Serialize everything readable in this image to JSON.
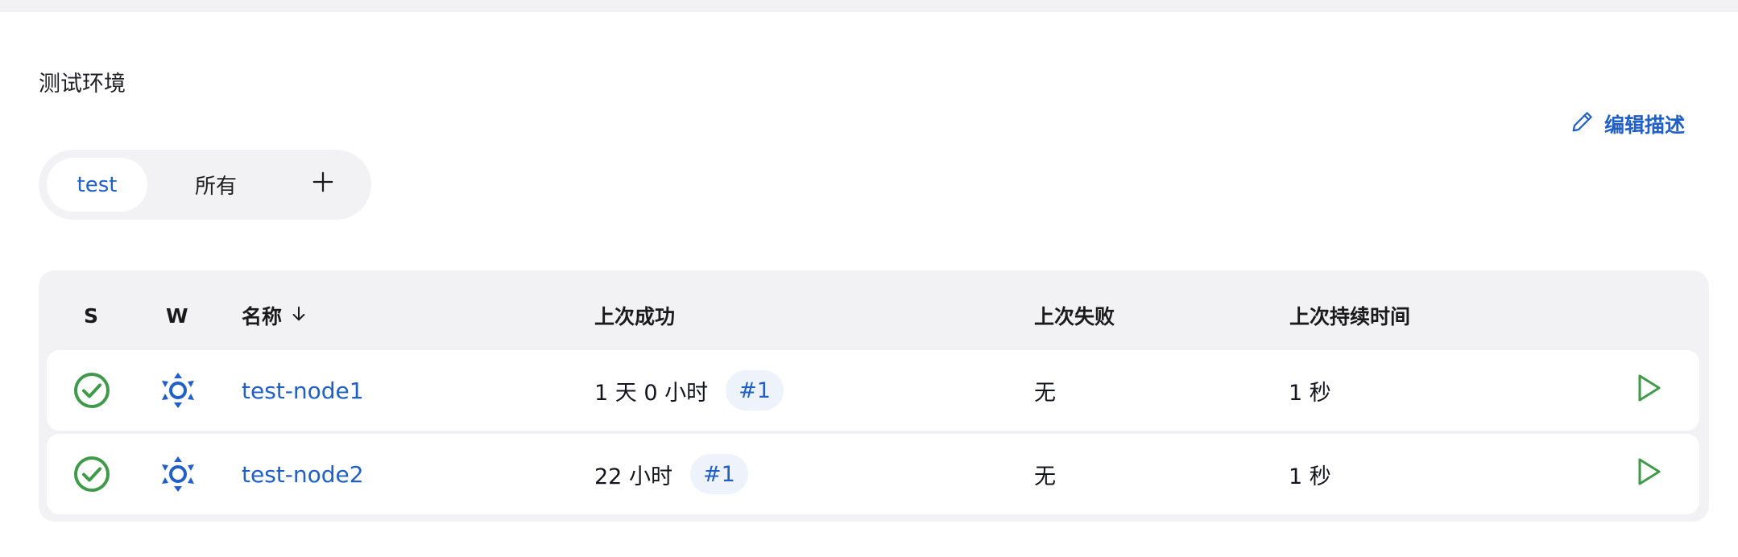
{
  "description": "测试环境",
  "edit_description": "编辑描述",
  "tabs": {
    "active": "test",
    "all": "所有",
    "add_icon": "plus-icon"
  },
  "table": {
    "headers": {
      "status": "S",
      "weather": "W",
      "name": "名称",
      "last_success": "上次成功",
      "last_failure": "上次失败",
      "last_duration": "上次持续时间"
    },
    "rows": [
      {
        "name": "test-node1",
        "last_success": "1 天 0 小时",
        "build": "#1",
        "last_failure": "无",
        "last_duration": "1 秒"
      },
      {
        "name": "test-node2",
        "last_success": "22 小时",
        "build": "#1",
        "last_failure": "无",
        "last_duration": "1 秒"
      }
    ]
  },
  "colors": {
    "accent": "#1f5fc8",
    "success": "#3f9a4a",
    "panel": "#f2f2f5"
  }
}
